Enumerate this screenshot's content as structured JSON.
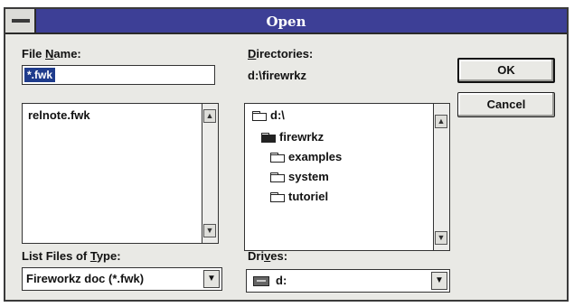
{
  "dialog": {
    "title": "Open",
    "file_name": {
      "label_pre": "File ",
      "label_accel": "N",
      "label_post": "ame:",
      "value": "*.fwk"
    },
    "files": [
      "relnote.fwk"
    ],
    "directories": {
      "label_accel": "D",
      "label_post": "irectories:",
      "current_path": "d:\\firewrkz",
      "tree": [
        {
          "name": "d:\\",
          "icon": "open-folder-icon"
        },
        {
          "name": "firewrkz",
          "icon": "open-folder-icon"
        },
        {
          "name": "examples",
          "icon": "folder-icon"
        },
        {
          "name": "system",
          "icon": "folder-icon"
        },
        {
          "name": "tutoriel",
          "icon": "folder-icon"
        }
      ]
    },
    "file_type": {
      "label_pre": "List Files of ",
      "label_accel": "T",
      "label_post": "ype:",
      "value": "Fireworkz doc (*.fwk)"
    },
    "drives": {
      "label_pre": "Dri",
      "label_accel": "v",
      "label_post": "es:",
      "value": "d:"
    },
    "buttons": {
      "ok": "OK",
      "cancel": "Cancel"
    },
    "icons": {
      "scroll_up": "▲",
      "scroll_down": "▼",
      "dropdown": "▼"
    }
  }
}
